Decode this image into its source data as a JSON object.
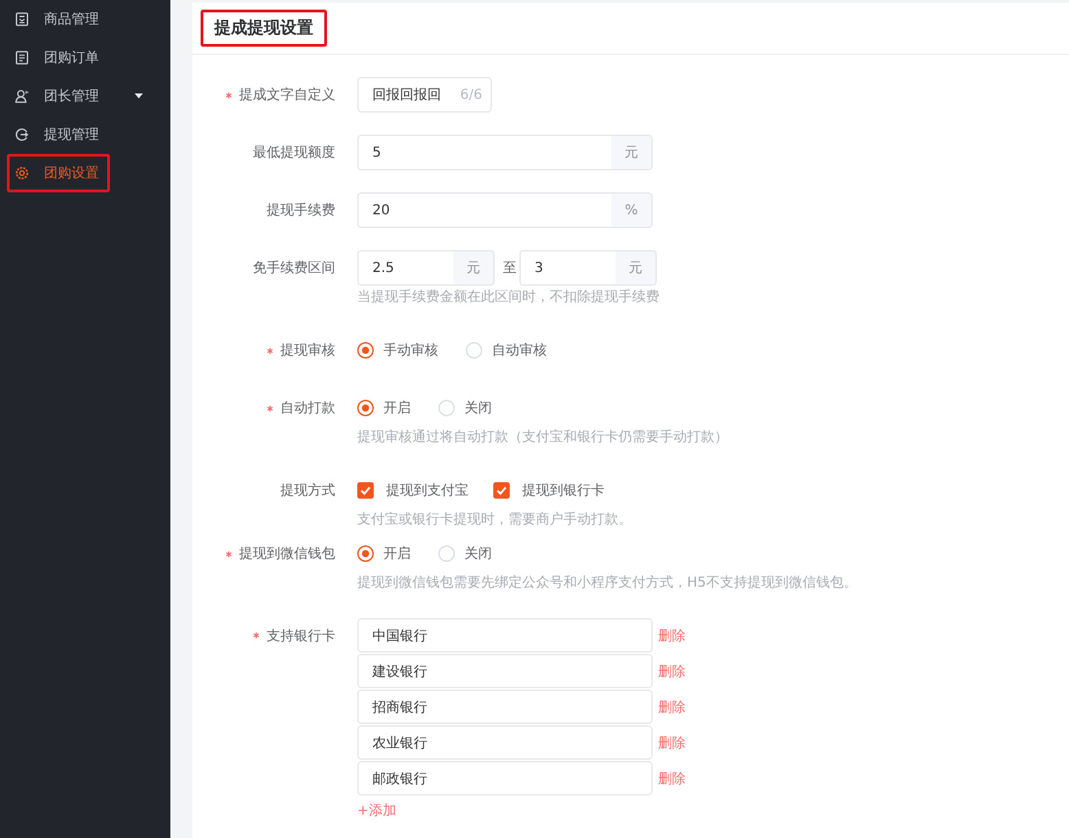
{
  "sidebar": {
    "items": [
      {
        "label": "商品管理",
        "selected": false,
        "highlighted": false,
        "expandable": false
      },
      {
        "label": "团购订单",
        "selected": false,
        "highlighted": false,
        "expandable": false
      },
      {
        "label": "团长管理",
        "selected": false,
        "highlighted": false,
        "expandable": true
      },
      {
        "label": "提现管理",
        "selected": false,
        "highlighted": false,
        "expandable": false
      },
      {
        "label": "团购设置",
        "selected": true,
        "highlighted": true,
        "expandable": false
      }
    ]
  },
  "header": {
    "title": "提成提现设置",
    "highlighted": true
  },
  "form": {
    "fields": [
      {
        "kind": "counter",
        "label": "提成文字自定义",
        "required": true,
        "value": "回报回报回",
        "counter": "6/6"
      },
      {
        "kind": "unit",
        "label": "最低提现额度",
        "required": false,
        "value": "5",
        "unit": "元"
      },
      {
        "kind": "unit",
        "label": "提现手续费",
        "required": false,
        "value": "20",
        "unit": "%"
      },
      {
        "kind": "range",
        "label": "免手续费区间",
        "required": false,
        "from": {
          "value": "2.5",
          "unit": "元"
        },
        "separator": "至",
        "to": {
          "value": "3",
          "unit": "元"
        },
        "hint": "当提现手续费金额在此区间时，不扣除提现手续费"
      },
      {
        "kind": "radio",
        "label": "提现审核",
        "required": true,
        "options": [
          {
            "label": "手动审核",
            "selected": true
          },
          {
            "label": "自动审核",
            "selected": false
          }
        ]
      },
      {
        "kind": "radio",
        "label": "自动打款",
        "required": true,
        "options": [
          {
            "label": "开启",
            "selected": true
          },
          {
            "label": "关闭",
            "selected": false
          }
        ],
        "hint": "提现审核通过将自动打款（支付宝和银行卡仍需要手动打款）"
      },
      {
        "kind": "checkbox",
        "label": "提现方式",
        "required": false,
        "options": [
          {
            "label": "提现到支付宝",
            "checked": true
          },
          {
            "label": "提现到银行卡",
            "checked": true
          }
        ],
        "hint": "支付宝或银行卡提现时，需要商户手动打款。"
      },
      {
        "kind": "radio",
        "label": "提现到微信钱包",
        "required": true,
        "options": [
          {
            "label": "开启",
            "selected": true
          },
          {
            "label": "关闭",
            "selected": false
          }
        ],
        "hint": "提现到微信钱包需要先绑定公众号和小程序支付方式，H5不支持提现到微信钱包。"
      },
      {
        "kind": "list",
        "label": "支持银行卡",
        "required": true,
        "items": [
          {
            "value": "中国银行",
            "action": "删除"
          },
          {
            "value": "建设银行",
            "action": "删除"
          },
          {
            "value": "招商银行",
            "action": "删除"
          },
          {
            "value": "农业银行",
            "action": "删除"
          },
          {
            "value": "邮政银行",
            "action": "删除"
          }
        ],
        "add": "+添加"
      }
    ]
  }
}
